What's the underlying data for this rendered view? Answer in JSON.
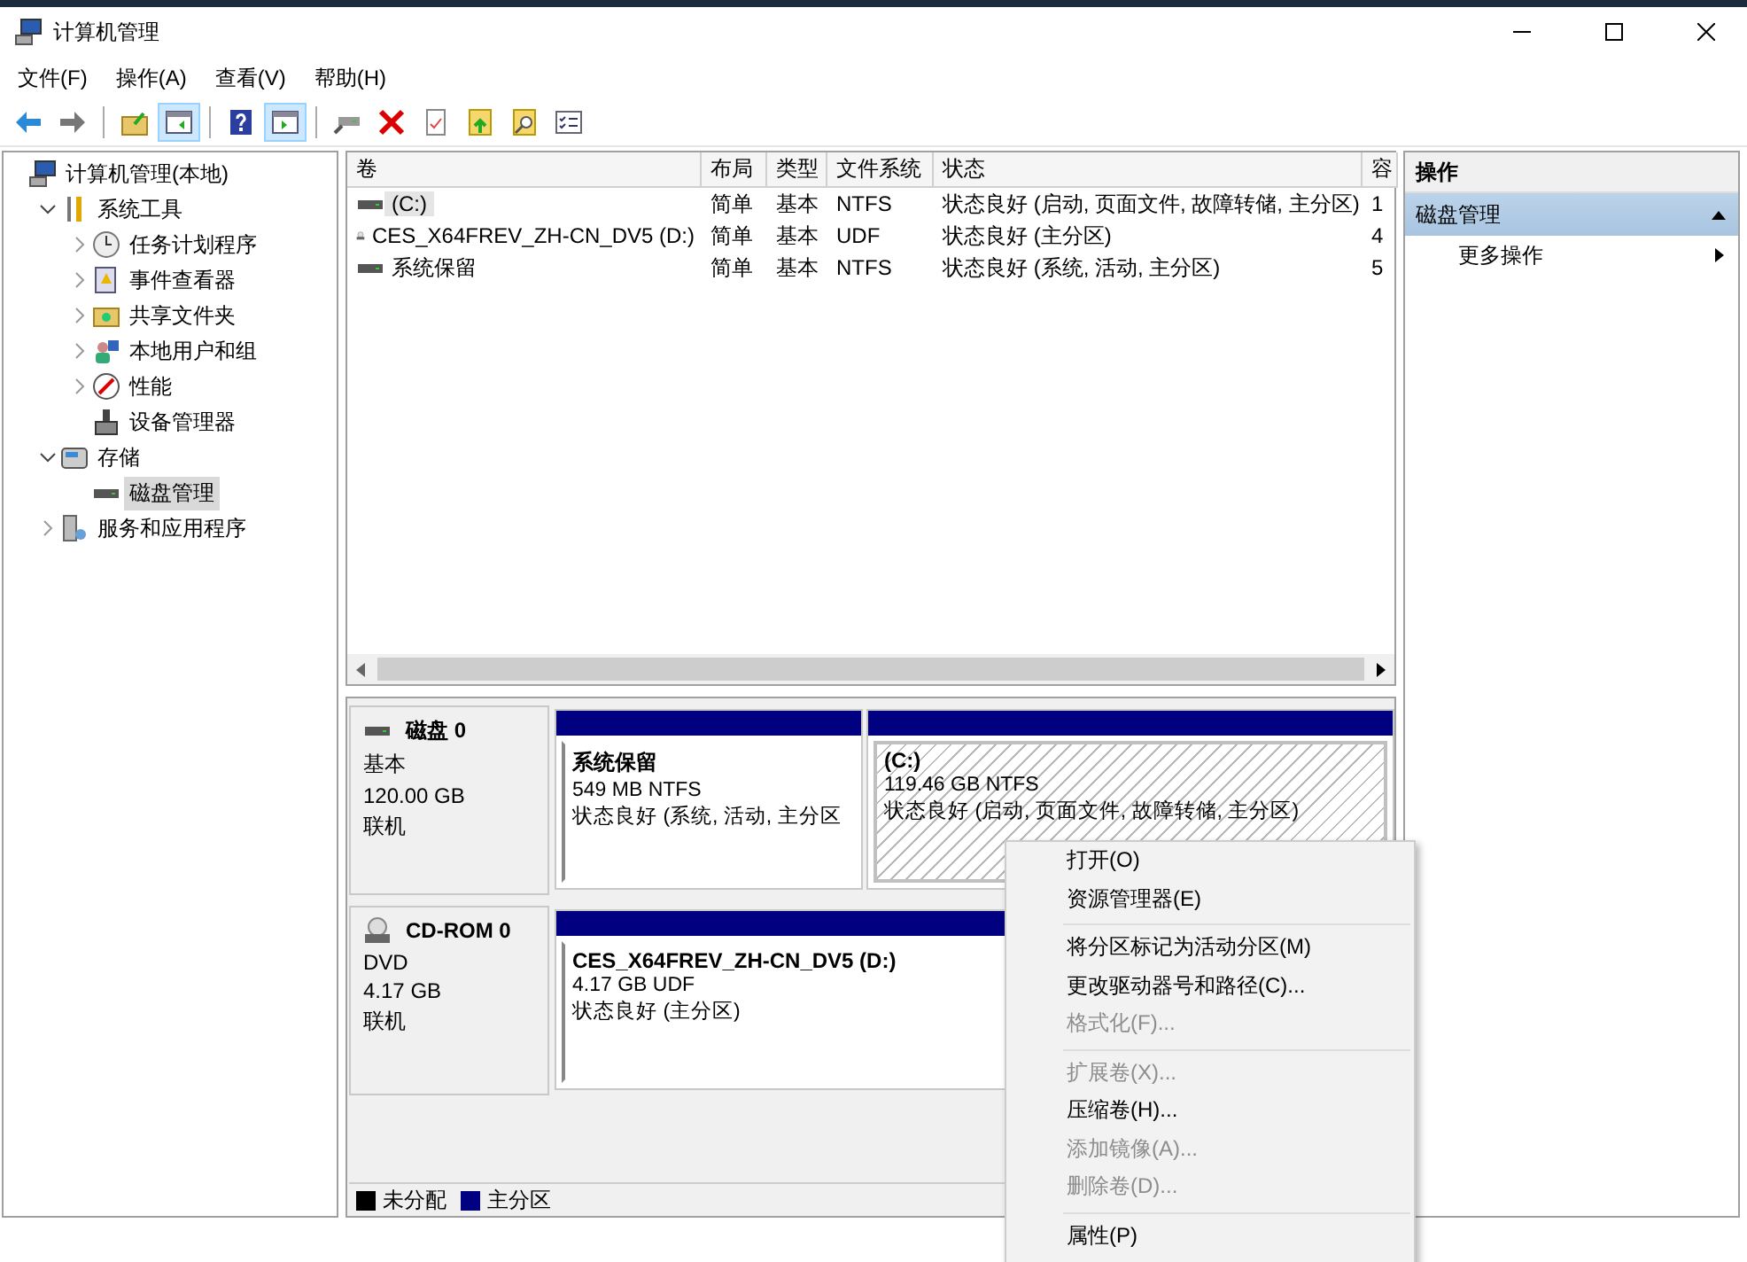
{
  "window": {
    "title": "计算机管理"
  },
  "menu": [
    {
      "label": "文件(F)"
    },
    {
      "label": "操作(A)"
    },
    {
      "label": "查看(V)"
    },
    {
      "label": "帮助(H)"
    }
  ],
  "toolbar": [
    {
      "kind": "back",
      "pressed": false
    },
    {
      "kind": "forward",
      "pressed": false
    },
    {
      "kind": "sep"
    },
    {
      "kind": "up-folder",
      "pressed": false
    },
    {
      "kind": "pane-left",
      "pressed": true
    },
    {
      "kind": "sep"
    },
    {
      "kind": "help",
      "pressed": false
    },
    {
      "kind": "pane-right",
      "pressed": true
    },
    {
      "kind": "sep"
    },
    {
      "kind": "connect",
      "pressed": false
    },
    {
      "kind": "delete",
      "pressed": false
    },
    {
      "kind": "check-doc",
      "pressed": false
    },
    {
      "kind": "folder-up",
      "pressed": false
    },
    {
      "kind": "folder-search",
      "pressed": false
    },
    {
      "kind": "checklist",
      "pressed": false
    }
  ],
  "tree": [
    {
      "label": "计算机管理(本地)",
      "kind": "computer",
      "selected": false,
      "children": [
        {
          "label": "系统工具",
          "kind": "tools",
          "expanded": true,
          "selected": false,
          "children": [
            {
              "label": "任务计划程序",
              "kind": "clock",
              "expanded": false,
              "selected": false
            },
            {
              "label": "事件查看器",
              "kind": "log",
              "expanded": false,
              "selected": false
            },
            {
              "label": "共享文件夹",
              "kind": "share",
              "expanded": false,
              "selected": false
            },
            {
              "label": "本地用户和组",
              "kind": "users",
              "expanded": false,
              "selected": false
            },
            {
              "label": "性能",
              "kind": "gauge",
              "expanded": false,
              "selected": false
            },
            {
              "label": "设备管理器",
              "kind": "device",
              "selected": false
            }
          ]
        },
        {
          "label": "存储",
          "kind": "storage",
          "expanded": true,
          "selected": false,
          "children": [
            {
              "label": "磁盘管理",
              "kind": "disk",
              "selected": true
            }
          ]
        },
        {
          "label": "服务和应用程序",
          "kind": "services",
          "expanded": false,
          "selected": false
        }
      ]
    }
  ],
  "volume_table": {
    "columns": [
      "卷",
      "布局",
      "类型",
      "文件系统",
      "状态",
      "容"
    ],
    "rows": [
      {
        "kind": "hdd",
        "selected": true,
        "cells": [
          "(C:)",
          "简单",
          "基本",
          "NTFS",
          "状态良好 (启动, 页面文件, 故障转储, 主分区)",
          "1"
        ]
      },
      {
        "kind": "cd",
        "selected": false,
        "cells": [
          "CES_X64FREV_ZH-CN_DV5 (D:)",
          "简单",
          "基本",
          "UDF",
          "状态良好 (主分区)",
          "4"
        ]
      },
      {
        "kind": "hdd",
        "selected": false,
        "cells": [
          "系统保留",
          "简单",
          "基本",
          "NTFS",
          "状态良好 (系统, 活动, 主分区)",
          "5"
        ]
      }
    ]
  },
  "disks": [
    {
      "kind": "hdd",
      "name": "磁盘 0",
      "type": "基本",
      "size": "120.00 GB",
      "state": "联机",
      "partitions": [
        {
          "name": "系统保留",
          "size": "549 MB NTFS",
          "status": "状态良好 (系统, 活动, 主分区",
          "selected": false
        },
        {
          "name": "(C:)",
          "size": "119.46 GB NTFS",
          "status": "状态良好 (启动, 页面文件, 故障转储, 主分区)",
          "selected": true
        }
      ]
    },
    {
      "kind": "cd",
      "name": "CD-ROM 0",
      "type": "DVD",
      "size": "4.17 GB",
      "state": "联机",
      "partitions": [
        {
          "name": "CES_X64FREV_ZH-CN_DV5  (D:)",
          "size": "4.17 GB UDF",
          "status": "状态良好 (主分区)",
          "selected": false
        }
      ]
    }
  ],
  "legend": [
    {
      "label": "未分配",
      "color": "#000000"
    },
    {
      "label": "主分区",
      "color": "#000080"
    }
  ],
  "actions": {
    "title": "操作",
    "section": {
      "label": "磁盘管理",
      "expanded": true
    },
    "items": [
      {
        "label": "更多操作"
      }
    ]
  },
  "context_menu": [
    {
      "kind": "item",
      "label": "打开(O)",
      "disabled": false
    },
    {
      "kind": "item",
      "label": "资源管理器(E)",
      "disabled": false
    },
    {
      "kind": "separator"
    },
    {
      "kind": "item",
      "label": "将分区标记为活动分区(M)",
      "disabled": false
    },
    {
      "kind": "item",
      "label": "更改驱动器号和路径(C)...",
      "disabled": false
    },
    {
      "kind": "item",
      "label": "格式化(F)...",
      "disabled": true
    },
    {
      "kind": "separator"
    },
    {
      "kind": "item",
      "label": "扩展卷(X)...",
      "disabled": true
    },
    {
      "kind": "item",
      "label": "压缩卷(H)...",
      "disabled": false
    },
    {
      "kind": "item",
      "label": "添加镜像(A)...",
      "disabled": true
    },
    {
      "kind": "item",
      "label": "删除卷(D)...",
      "disabled": true
    },
    {
      "kind": "separator"
    },
    {
      "kind": "item",
      "label": "属性(P)",
      "disabled": false
    }
  ]
}
